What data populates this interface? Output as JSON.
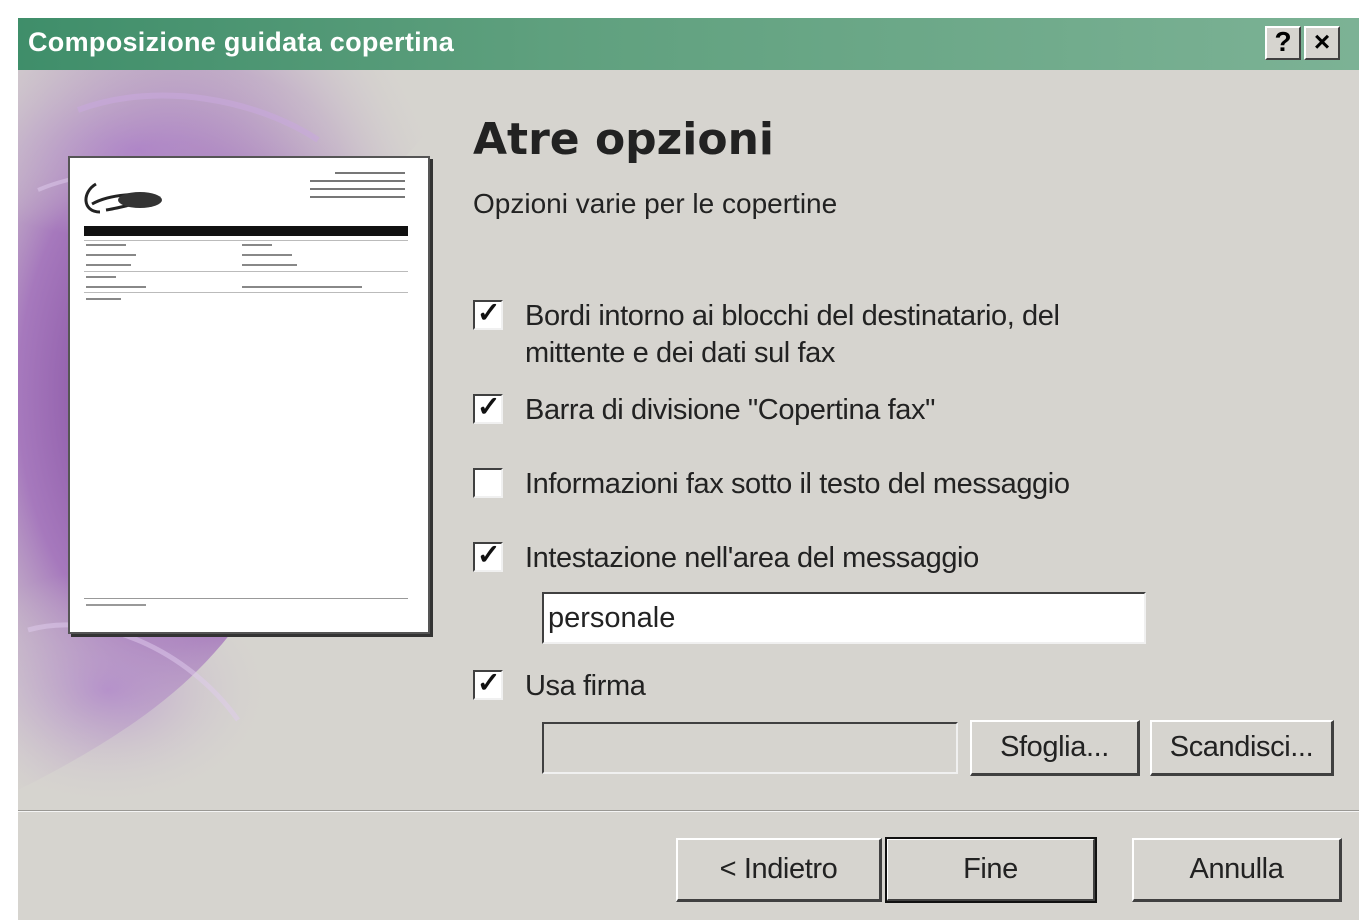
{
  "window": {
    "title": "Composizione guidata copertina",
    "help_glyph": "?",
    "close_glyph": "×"
  },
  "page": {
    "heading": "Atre opzioni",
    "subheading": "Opzioni varie per le copertine"
  },
  "options": [
    {
      "label": "Bordi intorno ai blocchi del destinatario, del\nmittente e dei dati sul fax",
      "checked": true
    },
    {
      "label": "Barra di divisione \"Copertina fax\"",
      "checked": true
    },
    {
      "label": "Informazioni fax sotto il testo del messaggio",
      "checked": false
    },
    {
      "label": "Intestazione nell'area del messaggio",
      "checked": true
    },
    {
      "label": "Usa firma",
      "checked": true
    }
  ],
  "heading_field": {
    "value": "personale"
  },
  "signature_field": {
    "value": ""
  },
  "buttons": {
    "browse": "Sfoglia...",
    "scan": "Scandisci...",
    "back": "< Indietro",
    "finish": "Fine",
    "cancel": "Annulla"
  },
  "check_glyph": "✓",
  "colors": {
    "titlebar": "#4f9773",
    "dialog_bg": "#d6d4cf",
    "accent_purple": "#8a55a8"
  }
}
